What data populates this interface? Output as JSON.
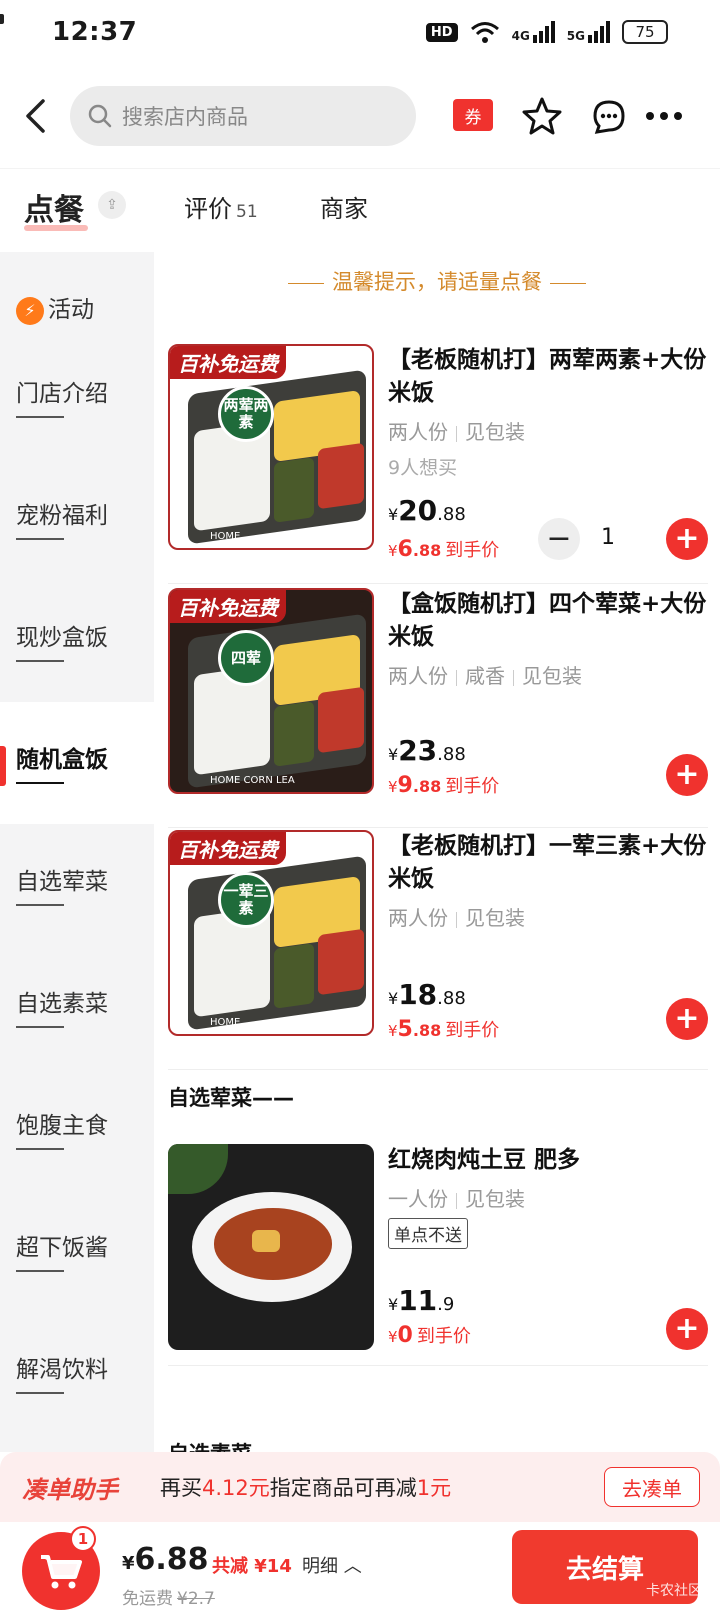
{
  "status": {
    "time": "12:37",
    "hd": "HD",
    "net1": "4G",
    "net2": "5G",
    "battery": "75"
  },
  "nav": {
    "search_placeholder": "搜索店内商品",
    "coupon": "券"
  },
  "tabs": {
    "order": "点餐",
    "reviews": "评价",
    "reviews_count": "51",
    "merchant": "商家"
  },
  "sidebar": {
    "items": [
      {
        "label": "活动"
      },
      {
        "label": "门店介绍"
      },
      {
        "label": "宠粉福利"
      },
      {
        "label": "现炒盒饭"
      },
      {
        "label": "随机盒饭"
      },
      {
        "label": "自选荤菜"
      },
      {
        "label": "自选素菜"
      },
      {
        "label": "饱腹主食"
      },
      {
        "label": "超下饭酱"
      },
      {
        "label": "解渴饮料"
      }
    ]
  },
  "tip": "温馨提示，请适量点餐",
  "products": [
    {
      "ribbon": "百补免运费",
      "seal": "两荤两素",
      "brand": "HOME",
      "title": "【老板随机打】两荤两素+大份米饭",
      "specs": [
        "两人份",
        "见包装"
      ],
      "want": "9人想买",
      "yen": "¥",
      "price_int": "20",
      "price_dec": ".88",
      "final_int": "6",
      "final_dec": ".88",
      "final_label": "到手价",
      "qty": "1"
    },
    {
      "ribbon": "百补免运费",
      "seal": "四荤",
      "brand": "HOME CORN LEA",
      "title": "【盒饭随机打】四个荤菜+大份米饭",
      "specs": [
        "两人份",
        "咸香",
        "见包装"
      ],
      "yen": "¥",
      "price_int": "23",
      "price_dec": ".88",
      "final_int": "9",
      "final_dec": ".88",
      "final_label": "到手价"
    },
    {
      "ribbon": "百补免运费",
      "seal": "一荤三素",
      "brand": "HOME",
      "title": "【老板随机打】一荤三素+大份米饭",
      "specs": [
        "两人份",
        "见包装"
      ],
      "yen": "¥",
      "price_int": "18",
      "price_dec": ".88",
      "final_int": "5",
      "final_dec": ".88",
      "final_label": "到手价"
    }
  ],
  "section2": {
    "title": "自选荤菜——"
  },
  "product4": {
    "title": "红烧肉炖土豆 肥多",
    "specs": [
      "一人份",
      "见包装"
    ],
    "tag": "单点不送",
    "yen": "¥",
    "price_int": "11",
    "price_dec": ".9",
    "final_int": "0",
    "final_label": "到手价"
  },
  "section3": {
    "title": "自选素菜"
  },
  "assistant": {
    "brand": "凑单助手",
    "msg_pre": "再买",
    "msg_amount": "4.12元",
    "msg_mid": "指定商品可再减",
    "msg_off": "1元",
    "go": "去凑单"
  },
  "cart": {
    "badge": "1",
    "yen": "¥",
    "total": "6.88",
    "discount": "共减 ¥14",
    "detail": "明细",
    "ship_label": "免运费",
    "ship_orig": "¥2.7",
    "checkout": "去结算",
    "watermark": "卡农社区"
  },
  "colors": {
    "accent": "#f0322e",
    "tip": "#d48a2c",
    "sidebar_bg": "#f4f4f5"
  }
}
